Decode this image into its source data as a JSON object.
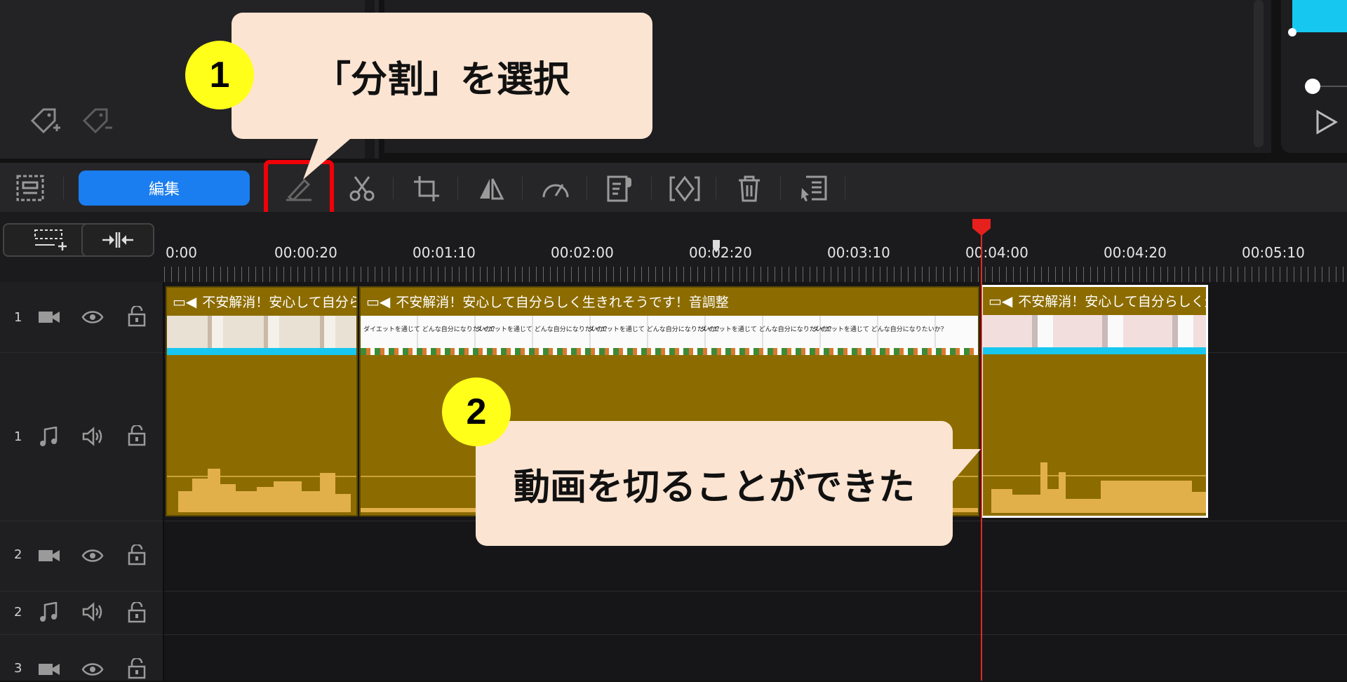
{
  "callouts": {
    "step1_number": "1",
    "step1_text": "「分割」を選択",
    "step2_number": "2",
    "step2_text": "動画を切ることができた"
  },
  "toolbar": {
    "edit_label": "編集",
    "tools": [
      "split-icon",
      "scissors-icon",
      "crop-icon",
      "flip-icon",
      "speed-icon",
      "voiceover-icon",
      "keyframe-icon",
      "trash-icon",
      "detail-icon"
    ]
  },
  "timeline": {
    "ruler_labels": [
      "0:00",
      "00:00:20",
      "00:01:10",
      "00:02:00",
      "00:02:20",
      "00:03:10",
      "00:04:00",
      "00:04:20",
      "00:05:10"
    ],
    "tracks": [
      {
        "number": "1",
        "type": "video"
      },
      {
        "number": "1",
        "type": "audio"
      },
      {
        "number": "2",
        "type": "video"
      },
      {
        "number": "2",
        "type": "audio"
      },
      {
        "number": "3",
        "type": "video"
      }
    ],
    "clips": [
      {
        "title": "不安解消！安心して自分ら"
      },
      {
        "title": "不安解消！安心して自分らしく生きれそうです！音調整",
        "banner_text": "ダイエットを通じて どんな自分になりたいか？"
      },
      {
        "title": "不安解消！安心して自分らしく生"
      }
    ]
  },
  "colors": {
    "accent_blue": "#1a7df0",
    "clip_gold": "#8c6c00",
    "playhead_red": "#e6201c",
    "highlight_red": "#f00008",
    "callout_bg": "#fce4d2",
    "badge_yellow": "#ffff1a"
  }
}
